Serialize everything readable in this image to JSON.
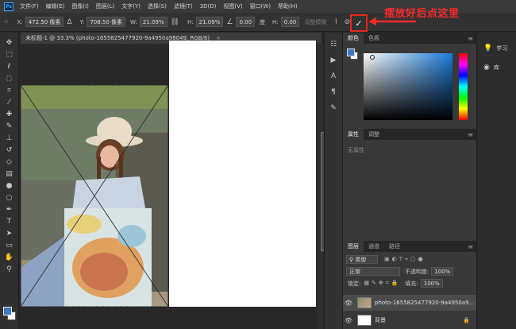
{
  "app": {
    "logo": "Ps",
    "menu": [
      "文件(F)",
      "编辑(E)",
      "图像(I)",
      "图层(L)",
      "文字(Y)",
      "选择(S)",
      "滤镜(T)",
      "3D(D)",
      "视图(V)",
      "窗口(W)",
      "帮助(H)"
    ]
  },
  "options": {
    "x_label": "X:",
    "x_value": "472.50 像素",
    "y_label": "Y:",
    "y_value": "708.50 像素",
    "w_label": "W:",
    "w_value": "21.09%",
    "h_label": "H:",
    "h_value": "21.09%",
    "angle_value": "0.00",
    "angle_unit": "度",
    "interp_label": "插值",
    "interp_value": "两次立方",
    "warp_label": "H:",
    "warp_value": "0.00",
    "deform_label": "调整模糊",
    "cancel_icon": "cancel-transform-icon",
    "commit_icon": "commit-transform-icon",
    "commit_glyph": "✓"
  },
  "annotation": {
    "text": "摆放好后点这里",
    "color": "#ff2a2a"
  },
  "document": {
    "tab_title": "未标题-1 @ 33.3% (photo-1655825477920-9a4950a98049, RGB/8)",
    "close_glyph": "×"
  },
  "tools": [
    "move-tool-icon",
    "marquee-tool-icon",
    "lasso-tool-icon",
    "quick-select-tool-icon",
    "crop-tool-icon",
    "eyedropper-tool-icon",
    "healing-brush-tool-icon",
    "brush-tool-icon",
    "clone-stamp-tool-icon",
    "history-brush-tool-icon",
    "eraser-tool-icon",
    "gradient-tool-icon",
    "blur-tool-icon",
    "dodge-tool-icon",
    "pen-tool-icon",
    "type-tool-icon",
    "path-select-tool-icon",
    "rectangle-tool-icon",
    "hand-tool-icon",
    "zoom-tool-icon"
  ],
  "color_panel": {
    "tabs": [
      "颜色",
      "色板"
    ],
    "fg_color": "#3d77c7",
    "bg_color": "#ffffff"
  },
  "props_panel": {
    "tabs": [
      "属性",
      "调整"
    ],
    "empty_text": "无属性"
  },
  "layers_panel": {
    "tabs": [
      "图层",
      "通道",
      "路径"
    ],
    "filter_label": "类型",
    "blend_mode": "正常",
    "opacity_label": "不透明度:",
    "opacity_value": "100%",
    "lock_label": "锁定:",
    "fill_label": "填充:",
    "fill_value": "100%",
    "layers": [
      {
        "name": "photo-1655825477920-9a4950a9...",
        "selected": true
      },
      {
        "name": "背景",
        "selected": false
      }
    ]
  },
  "right_strip": {
    "learn_label": "学习",
    "library_label": "库"
  }
}
